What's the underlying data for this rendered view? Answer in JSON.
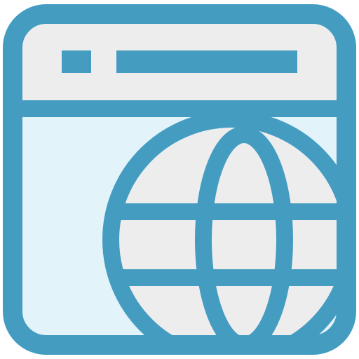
{
  "icon": {
    "name": "web-browser-globe-icon",
    "colors": {
      "stroke": "#449CC1",
      "titlebar_fill": "#EDEDED",
      "content_fill": "#E3F3FA",
      "globe_fill": "#EDEDED",
      "background": "#FFFFFF"
    }
  }
}
